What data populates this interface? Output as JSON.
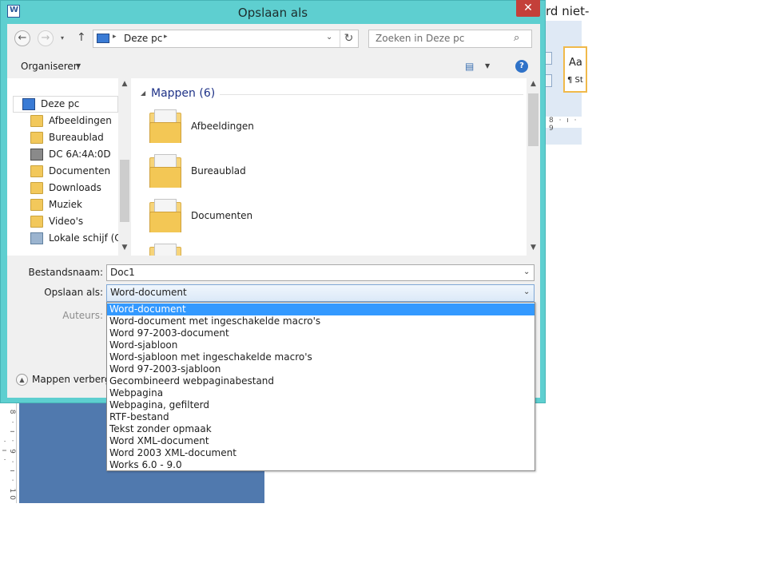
{
  "background_window": {
    "title_fragment": "rd niet-",
    "style_preview": "Aa",
    "style_name": "¶ St",
    "ruler_top": "8 · ı · 9",
    "ruler_left": "· 8 · ı · 9 · ı · 10 · ı ·"
  },
  "dialog": {
    "title": "Opslaan als",
    "close_glyph": "✕"
  },
  "address_bar": {
    "back_glyph": "←",
    "forward_glyph": "→",
    "recent_glyph": "▾",
    "up_glyph": "↑",
    "separator_glyph": "▸",
    "location": "Deze pc",
    "dropdown_glyph": "⌄",
    "refresh_glyph": "↻"
  },
  "search": {
    "placeholder": "Zoeken in Deze pc",
    "icon_glyph": "⌕"
  },
  "toolbar": {
    "organize_label": "Organiseren",
    "arrow_glyph": "▼",
    "view_glyph": "▤",
    "help_glyph": "?"
  },
  "nav": {
    "scroll_up": "▲",
    "scroll_down": "▼",
    "items": [
      {
        "label": "Deze pc",
        "icon": "pc-icon"
      },
      {
        "label": "Afbeeldingen",
        "icon": "folder-icon"
      },
      {
        "label": "Bureaublad",
        "icon": "folder-icon"
      },
      {
        "label": "DC 6A:4A:0D",
        "icon": "media-device-icon"
      },
      {
        "label": "Documenten",
        "icon": "folder-icon"
      },
      {
        "label": "Downloads",
        "icon": "folder-icon"
      },
      {
        "label": "Muziek",
        "icon": "folder-icon"
      },
      {
        "label": "Video's",
        "icon": "folder-icon"
      },
      {
        "label": "Lokale schijf (C:)",
        "icon": "drive-icon"
      }
    ]
  },
  "content": {
    "group_arrow": "◢",
    "group_title": "Mappen (6)",
    "folders": [
      {
        "label": "Afbeeldingen"
      },
      {
        "label": "Bureaublad"
      },
      {
        "label": "Documenten"
      },
      {
        "label": ""
      }
    ]
  },
  "form": {
    "filename_label": "Bestandsnaam:",
    "filename_value": "Doc1",
    "savetype_label": "Opslaan als:",
    "savetype_value": "Word-document",
    "authors_label": "Auteurs:",
    "hide_folders_label": "Mappen verberge",
    "hide_folders_glyph": "▲",
    "drop_glyph": "⌄"
  },
  "savetype_options": [
    "Word-document",
    "Word-document met ingeschakelde macro's",
    "Word 97-2003-document",
    "Word-sjabloon",
    "Word-sjabloon met ingeschakelde macro's",
    "Word 97-2003-sjabloon",
    "Gecombineerd webpaginabestand",
    "Webpagina",
    "Webpagina, gefilterd",
    "RTF-bestand",
    "Tekst zonder opmaak",
    "Word XML-document",
    "Word 2003 XML-document",
    "Works 6.0 - 9.0"
  ],
  "colors": {
    "frame": "#5ecfd0",
    "selection": "#3399ff",
    "close": "#c4403a",
    "group_title": "#1e3287"
  }
}
